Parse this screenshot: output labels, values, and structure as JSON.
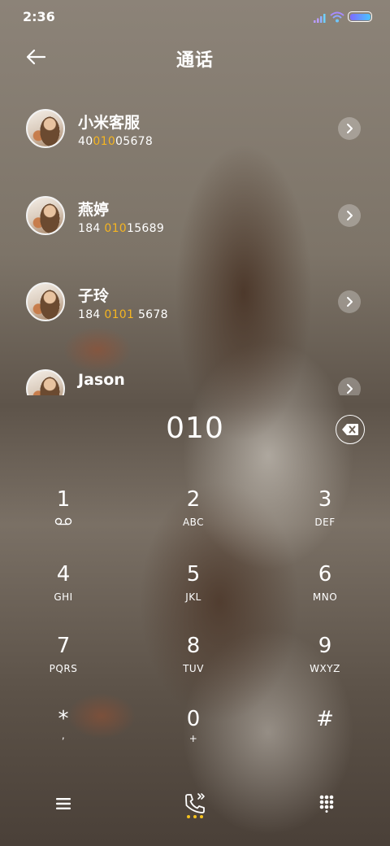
{
  "status_bar": {
    "time": "2:36",
    "battery_level": 1.0,
    "battery_colors": [
      "#7d6bff",
      "#4bc4ff"
    ]
  },
  "header": {
    "title": "通话",
    "back_icon": "arrow-left-icon"
  },
  "accent_color": "#f5b521",
  "contacts": [
    {
      "name": "小米客服",
      "number_parts": [
        "40",
        "010",
        "05678"
      ]
    },
    {
      "name": "燕婷",
      "number_parts": [
        "184 ",
        "010",
        "15689"
      ]
    },
    {
      "name": "子玲",
      "number_parts": [
        "184 ",
        "0101",
        " 5678"
      ]
    },
    {
      "name": "Jason",
      "number_parts": [
        "",
        "",
        ""
      ]
    }
  ],
  "dialer": {
    "input": "010",
    "delete_icon": "backspace-icon"
  },
  "keypad": [
    {
      "digit": "1",
      "letters": "",
      "icon": "voicemail-icon"
    },
    {
      "digit": "2",
      "letters": "ABC"
    },
    {
      "digit": "3",
      "letters": "DEF"
    },
    {
      "digit": "4",
      "letters": "GHI"
    },
    {
      "digit": "5",
      "letters": "JKL"
    },
    {
      "digit": "6",
      "letters": "MNO"
    },
    {
      "digit": "7",
      "letters": "PQRS"
    },
    {
      "digit": "8",
      "letters": "TUV"
    },
    {
      "digit": "9",
      "letters": "WXYZ"
    },
    {
      "digit": "*",
      "letters": ","
    },
    {
      "digit": "0",
      "letters": "+"
    },
    {
      "digit": "#",
      "letters": ""
    }
  ],
  "bottom_bar": {
    "left_icon": "menu-icon",
    "center_icon": "phone-call-icon",
    "right_icon": "dialpad-icon",
    "dots_color": "#f5c21d"
  }
}
